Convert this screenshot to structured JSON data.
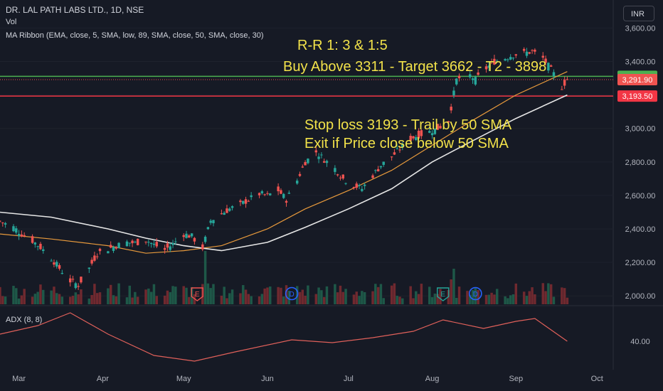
{
  "header": {
    "symbol": "DR. LAL PATH LABS LTD., 1D, NSE",
    "vol_label": "Vol",
    "ma_ribbon": "MA Ribbon (EMA, close, 5, SMA, low, 89, SMA, close, 50, SMA, close, 30)",
    "currency": "INR"
  },
  "annotations": {
    "line1": "R-R 1: 3 & 1:5",
    "line2": "Buy Above 3311 - Target 3662 - T2 - 3898",
    "line3": "Stop  loss 3193 - Trail by 50 SMA",
    "line4": "Exit if Price close below 50 SMA",
    "color": "#f2e24a"
  },
  "indicator": {
    "label": "ADX (8, 8)",
    "tick": "40.00"
  },
  "price_labels": {
    "buy": "3,311.25",
    "last": "3,291.90",
    "stop": "3,193.50"
  },
  "event_markers": [
    {
      "label": "E",
      "kind": "earnings",
      "date": "2023-05-06"
    },
    {
      "label": "D",
      "kind": "dividend",
      "date": "2023-06-10"
    },
    {
      "label": "E",
      "kind": "earnings",
      "date": "2023-08-05"
    },
    {
      "label": "D",
      "kind": "dividend",
      "date": "2023-08-17"
    }
  ],
  "chart_data": {
    "type": "candlestick",
    "title": "DR. LAL PATH LABS LTD., 1D, NSE",
    "y_ticks": [
      "3,600.00",
      "3,400.00",
      "3,200.00",
      "3,000.00",
      "2,800.00",
      "2,600.00",
      "2,400.00",
      "2,200.00",
      "2,000.00"
    ],
    "y_tick_values": [
      3600,
      3400,
      3200,
      3000,
      2800,
      2600,
      2400,
      2200,
      2000
    ],
    "ylim": [
      1950,
      3640
    ],
    "x_ticks": [
      "Mar",
      "Apr",
      "May",
      "Jun",
      "Jul",
      "Aug",
      "Sep",
      "Oct"
    ],
    "x_tick_dates": [
      "2023-03-01",
      "2023-04-01",
      "2023-05-01",
      "2023-06-01",
      "2023-07-01",
      "2023-08-01",
      "2023-09-01",
      "2023-10-01"
    ],
    "xlim": [
      "2023-02-22",
      "2023-10-07"
    ],
    "horizontal_lines": [
      {
        "name": "Buy",
        "value": 3311.25,
        "color": "#4caf50"
      },
      {
        "name": "Stop",
        "value": 3193.5,
        "color": "#f23645"
      }
    ],
    "last_price": 3291.9,
    "up_color": "#26a69a",
    "down_color": "#ef5350",
    "close_series": [
      [
        "2023-02-22",
        2445
      ],
      [
        "2023-02-27",
        2410
      ],
      [
        "2023-03-02",
        2370
      ],
      [
        "2023-03-06",
        2330
      ],
      [
        "2023-03-09",
        2290
      ],
      [
        "2023-03-13",
        2225
      ],
      [
        "2023-03-16",
        2165
      ],
      [
        "2023-03-20",
        2090
      ],
      [
        "2023-03-23",
        2065
      ],
      [
        "2023-03-27",
        2165
      ],
      [
        "2023-03-30",
        2255
      ],
      [
        "2023-04-03",
        2280
      ],
      [
        "2023-04-06",
        2300
      ],
      [
        "2023-04-10",
        2320
      ],
      [
        "2023-04-13",
        2315
      ],
      [
        "2023-04-17",
        2335
      ],
      [
        "2023-04-20",
        2305
      ],
      [
        "2023-04-24",
        2275
      ],
      [
        "2023-04-27",
        2310
      ],
      [
        "2023-05-01",
        2370
      ],
      [
        "2023-05-04",
        2355
      ],
      [
        "2023-05-08",
        2285
      ],
      [
        "2023-05-11",
        2450
      ],
      [
        "2023-05-15",
        2490
      ],
      [
        "2023-05-18",
        2520
      ],
      [
        "2023-05-22",
        2545
      ],
      [
        "2023-05-25",
        2575
      ],
      [
        "2023-05-29",
        2610
      ],
      [
        "2023-06-01",
        2600
      ],
      [
        "2023-06-05",
        2630
      ],
      [
        "2023-06-08",
        2575
      ],
      [
        "2023-06-12",
        2690
      ],
      [
        "2023-06-15",
        2800
      ],
      [
        "2023-06-19",
        2860
      ],
      [
        "2023-06-22",
        2815
      ],
      [
        "2023-06-26",
        2760
      ],
      [
        "2023-06-29",
        2700
      ],
      [
        "2023-07-03",
        2660
      ],
      [
        "2023-07-06",
        2640
      ],
      [
        "2023-07-10",
        2720
      ],
      [
        "2023-07-13",
        2780
      ],
      [
        "2023-07-17",
        2830
      ],
      [
        "2023-07-20",
        2880
      ],
      [
        "2023-07-24",
        2940
      ],
      [
        "2023-07-27",
        2960
      ],
      [
        "2023-07-31",
        2980
      ],
      [
        "2023-08-03",
        3000
      ],
      [
        "2023-08-07",
        3045
      ],
      [
        "2023-08-10",
        3290
      ],
      [
        "2023-08-14",
        3330
      ],
      [
        "2023-08-17",
        3290
      ],
      [
        "2023-08-21",
        3360
      ],
      [
        "2023-08-24",
        3400
      ],
      [
        "2023-08-28",
        3420
      ],
      [
        "2023-08-31",
        3440
      ],
      [
        "2023-09-04",
        3450
      ],
      [
        "2023-09-07",
        3460
      ],
      [
        "2023-09-11",
        3420
      ],
      [
        "2023-09-14",
        3350
      ],
      [
        "2023-09-18",
        3250
      ],
      [
        "2023-09-20",
        3291.9
      ]
    ],
    "series": [
      {
        "name": "SMA 30",
        "color": "#e89a3c",
        "values": [
          [
            "2023-02-22",
            2370
          ],
          [
            "2023-03-13",
            2340
          ],
          [
            "2023-04-03",
            2300
          ],
          [
            "2023-04-17",
            2255
          ],
          [
            "2023-05-01",
            2270
          ],
          [
            "2023-05-15",
            2300
          ],
          [
            "2023-06-01",
            2400
          ],
          [
            "2023-06-15",
            2520
          ],
          [
            "2023-07-01",
            2630
          ],
          [
            "2023-07-17",
            2750
          ],
          [
            "2023-08-01",
            2900
          ],
          [
            "2023-08-14",
            3030
          ],
          [
            "2023-09-01",
            3200
          ],
          [
            "2023-09-20",
            3340
          ]
        ]
      },
      {
        "name": "SMA 50",
        "color": "#e6e6e6",
        "values": [
          [
            "2023-02-22",
            2500
          ],
          [
            "2023-03-13",
            2470
          ],
          [
            "2023-04-03",
            2400
          ],
          [
            "2023-04-17",
            2345
          ],
          [
            "2023-05-01",
            2300
          ],
          [
            "2023-05-15",
            2270
          ],
          [
            "2023-06-01",
            2320
          ],
          [
            "2023-06-15",
            2410
          ],
          [
            "2023-07-01",
            2520
          ],
          [
            "2023-07-17",
            2640
          ],
          [
            "2023-08-01",
            2800
          ],
          [
            "2023-08-14",
            2910
          ],
          [
            "2023-09-01",
            3060
          ],
          [
            "2023-09-20",
            3200
          ]
        ]
      }
    ]
  }
}
